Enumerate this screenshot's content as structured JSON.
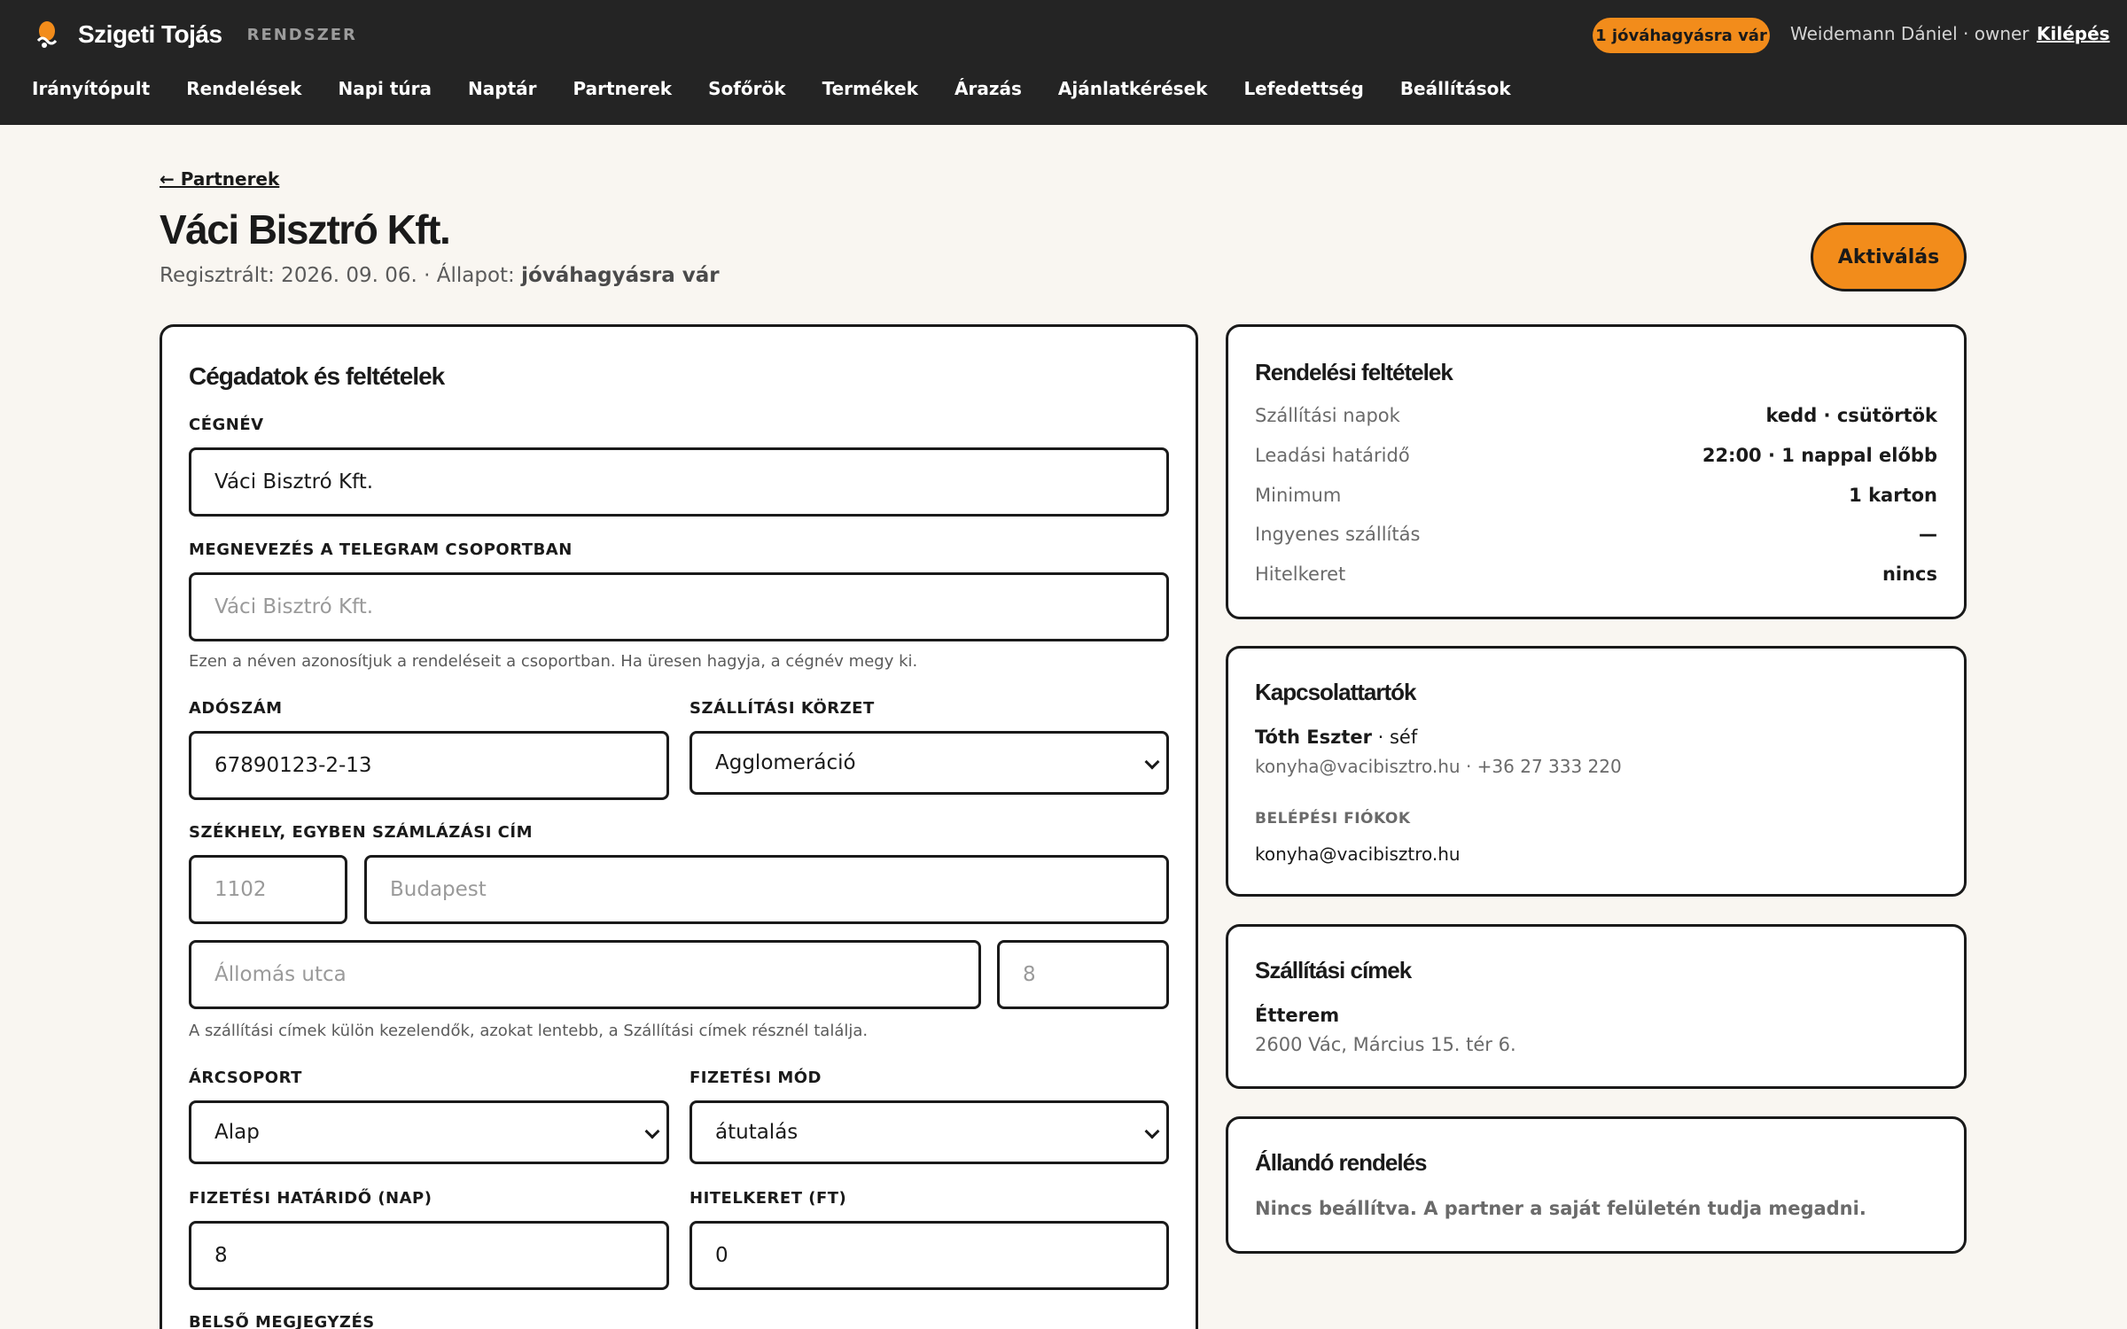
{
  "app": {
    "brand": "Szigeti Tojás",
    "subtitle": "RENDSZER",
    "pending_badge": "1 jóváhagyásra vár",
    "user": "Weidemann Dániel · owner",
    "logout": "Kilépés"
  },
  "nav": [
    "Irányítópult",
    "Rendelések",
    "Napi túra",
    "Naptár",
    "Partnerek",
    "Sofőrök",
    "Termékek",
    "Árazás",
    "Ajánlatkérések",
    "Lefedettség",
    "Beállítások"
  ],
  "header": {
    "back": "← Partnerek",
    "title": "Váci Bisztró Kft.",
    "registered_prefix": "Regisztrált: 2026. 09. 06. · Állapot: ",
    "status": "jóváhagyásra vár",
    "activate": "Aktiválás"
  },
  "company": {
    "title": "Cégadatok és feltételek",
    "name_label": "CÉGNÉV",
    "name_value": "Váci Bisztró Kft.",
    "telegram_label": "MEGNEVEZÉS A TELEGRAM CSOPORTBAN",
    "telegram_placeholder": "Váci Bisztró Kft.",
    "telegram_help": "Ezen a néven azonosítjuk a rendeléseit a csoportban. Ha üresen hagyja, a cégnév megy ki.",
    "tax_label": "ADÓSZÁM",
    "tax_value": "67890123-2-13",
    "zone_label": "SZÁLLÍTÁSI KÖRZET",
    "zone_value": "Agglomeráció",
    "address_label": "SZÉKHELY, EGYBEN SZÁMLÁZÁSI CÍM",
    "zip_placeholder": "1102",
    "city_placeholder": "Budapest",
    "street_placeholder": "Állomás utca",
    "number_placeholder": "8",
    "address_help": "A szállítási címek külön kezelendők, azokat lentebb, a Szállítási címek résznél találja.",
    "price_group_label": "ÁRCSOPORT",
    "price_group_value": "Alap",
    "payment_label": "FIZETÉSI MÓD",
    "payment_value": "átutalás",
    "deadline_label": "FIZETÉSI HATÁRIDŐ (NAP)",
    "deadline_value": "8",
    "credit_label": "HITELKERET (FT)",
    "credit_value": "0",
    "note_label": "BELSŐ MEGJEGYZÉS"
  },
  "order_terms": {
    "title": "Rendelési feltételek",
    "rows": [
      {
        "k": "Szállítási napok",
        "v": "kedd · csütörtök"
      },
      {
        "k": "Leadási határidő",
        "v": "22:00 · 1 nappal előbb"
      },
      {
        "k": "Minimum",
        "v": "1 karton"
      },
      {
        "k": "Ingyenes szállítás",
        "v": "—"
      },
      {
        "k": "Hitelkeret",
        "v": "nincs"
      }
    ]
  },
  "contacts": {
    "title": "Kapcsolattartók",
    "name": "Tóth Eszter",
    "role": " · séf",
    "details": "konyha@vacibisztro.hu · +36 27 333 220",
    "login_label": "BELÉPÉSI FIÓKOK",
    "login_value": "konyha@vacibisztro.hu"
  },
  "shipping": {
    "title": "Szállítási címek",
    "name": "Étterem",
    "address": "2600 Vác, Március 15. tér 6."
  },
  "standing": {
    "title": "Állandó rendelés",
    "text": "Nincs beállítva. A partner a saját felületén tudja megadni."
  },
  "colors": {
    "accent": "#f28c1b",
    "topbar": "#242424",
    "background": "#f9f6f1"
  }
}
